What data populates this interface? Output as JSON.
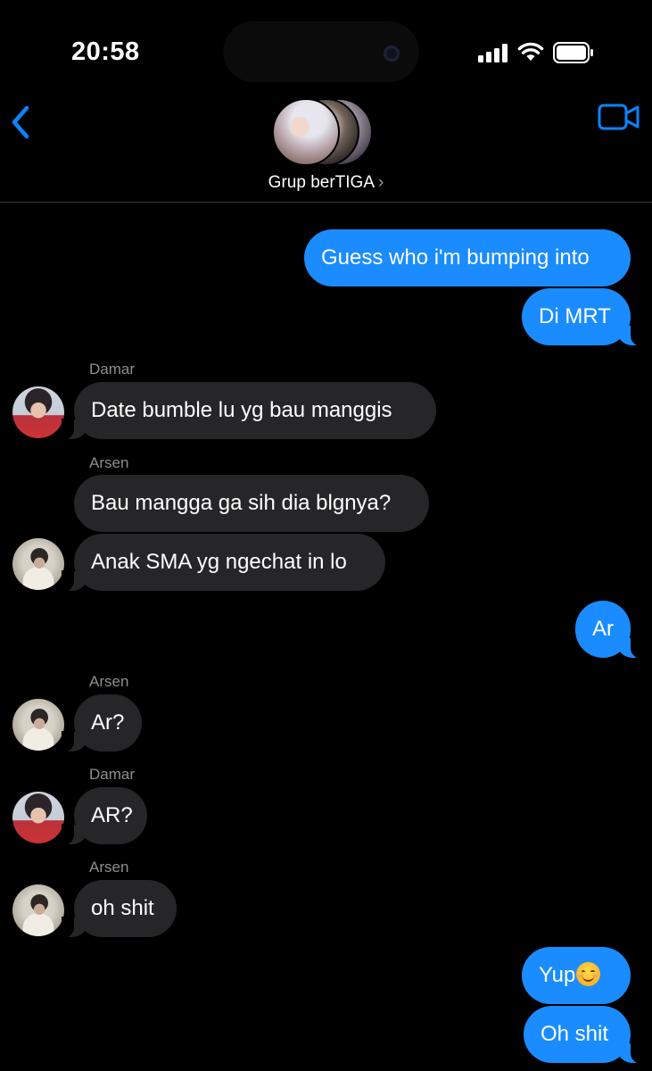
{
  "status_bar": {
    "time": "20:58"
  },
  "header": {
    "group_name": "Grup berTIGA",
    "chevron": "›"
  },
  "icons": {
    "back": "chevron-left-icon",
    "video": "video-camera-icon",
    "details": "chevron-right-icon"
  },
  "colors": {
    "outgoing_bubble": "#1a8cff",
    "incoming_bubble": "#262628",
    "accent": "#0a84ff",
    "sender_label": "#8e8e93"
  },
  "messages": [
    {
      "direction": "outgoing",
      "text": "Guess who i'm bumping into"
    },
    {
      "direction": "outgoing",
      "text": "Di MRT"
    },
    {
      "direction": "incoming",
      "sender": "Damar",
      "text": "Date bumble lu yg bau manggis"
    },
    {
      "direction": "incoming",
      "sender": "Arsen",
      "text": "Bau mangga ga sih dia blgnya?"
    },
    {
      "direction": "incoming",
      "sender": "Arsen",
      "text": "Anak SMA yg ngechat in lo"
    },
    {
      "direction": "outgoing",
      "text": "Ar"
    },
    {
      "direction": "incoming",
      "sender": "Arsen",
      "text": "Ar?"
    },
    {
      "direction": "incoming",
      "sender": "Damar",
      "text": "AR?"
    },
    {
      "direction": "incoming",
      "sender": "Arsen",
      "text": "oh shit"
    },
    {
      "direction": "outgoing",
      "text": "Yup",
      "emoji": "smiling-face-icon"
    },
    {
      "direction": "outgoing",
      "text": "Oh shit"
    }
  ]
}
